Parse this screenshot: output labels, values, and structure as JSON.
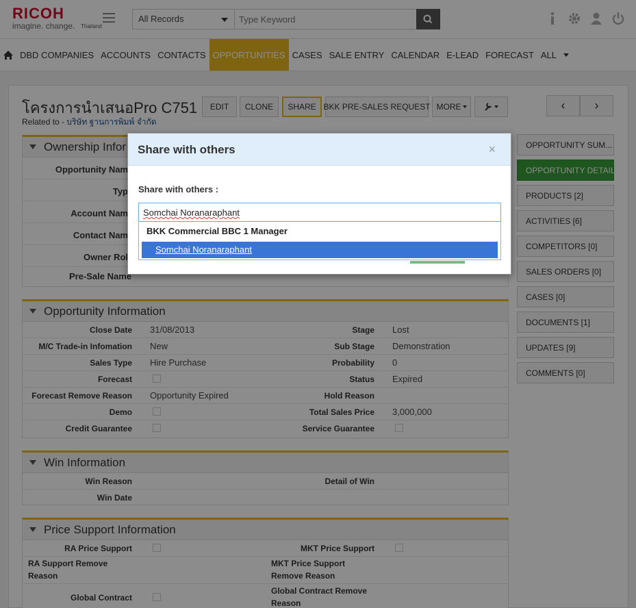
{
  "header": {
    "logo_main": "RICOH",
    "logo_sub": "imagine. change.",
    "logo_country": "Thailand",
    "record_filter": "All Records",
    "search_placeholder": "Type Keyword"
  },
  "nav": {
    "items": [
      "DBD COMPANIES",
      "ACCOUNTS",
      "CONTACTS",
      "OPPORTUNITIES",
      "CASES",
      "SALE ENTRY",
      "CALENDAR",
      "E-LEAD",
      "FORECAST",
      "ALL"
    ],
    "active": "OPPORTUNITIES"
  },
  "record": {
    "title": "โครงการนำเสนอPro C751",
    "related_prefix": "Related to - ",
    "related_link": "บริษัท ฐานการพิมพ์ จำกัด"
  },
  "actions": {
    "edit": "EDIT",
    "clone": "CLONE",
    "share": "SHARE",
    "bkk_request": "BKK PRE-SALES REQUEST",
    "more": "MORE",
    "prev": "‹",
    "next": "›"
  },
  "ownership": {
    "title": "Ownership Infor",
    "labels": [
      "Opportunity Nam",
      "Typ",
      "Account Nam",
      "Contact Nam",
      "Owner Rol",
      "Pre-Sale Name"
    ]
  },
  "opportunity": {
    "title": "Opportunity Information",
    "rows": [
      {
        "l1": "Close Date",
        "v1": "31/08/2013",
        "l2": "Stage",
        "v2": "Lost"
      },
      {
        "l1": "M/C Trade-in Infomation",
        "v1": "New",
        "l2": "Sub Stage",
        "v2": "Demonstration"
      },
      {
        "l1": "Sales Type",
        "v1": "Hire Purchase",
        "l2": "Probability",
        "v2": "0"
      },
      {
        "l1": "Forecast",
        "v1": "",
        "l2": "Status",
        "v2": "Expired"
      },
      {
        "l1": "Forecast Remove Reason",
        "v1": "Opportunity Expired",
        "l2": "Hold Reason",
        "v2": ""
      },
      {
        "l1": "Demo",
        "v1": "",
        "l2": "Total Sales Price",
        "v2": "3,000,000"
      },
      {
        "l1": "Credit Guarantee",
        "v1": "",
        "l2": "Service Guarantee",
        "v2": ""
      }
    ]
  },
  "win": {
    "title": "Win Information",
    "win_reason": "Win Reason",
    "detail_of_win": "Detail of Win",
    "win_date": "Win Date"
  },
  "price": {
    "title": "Price Support Information",
    "ra_support": "RA Price Support",
    "mkt_support": "MKT Price Support",
    "ra_remove_1": "RA Support Remove",
    "ra_remove_2": "Reason",
    "mkt_remove_1": "MKT Price Support",
    "mkt_remove_2": "Remove Reason",
    "global_contract": "Global Contract",
    "global_remove_1": "Global Contract Remove",
    "global_remove_2": "Reason"
  },
  "side_tabs": [
    "OPPORTUNITY SUM...",
    "OPPORTUNITY DETAIL",
    "PRODUCTS [2]",
    "ACTIVITIES [6]",
    "COMPETITORS [0]",
    "SALES ORDERS [0]",
    "CASES [0]",
    "DOCUMENTS [1]",
    "UPDATES [9]",
    "COMMENTS [0]"
  ],
  "modal": {
    "title": "Share with others",
    "close": "×",
    "label": "Share with others :",
    "input_value": "Somchai Noranaraphant",
    "group_label": "BKK Commercial BBC 1 Manager",
    "option": "Somchai Noranaraphant"
  }
}
